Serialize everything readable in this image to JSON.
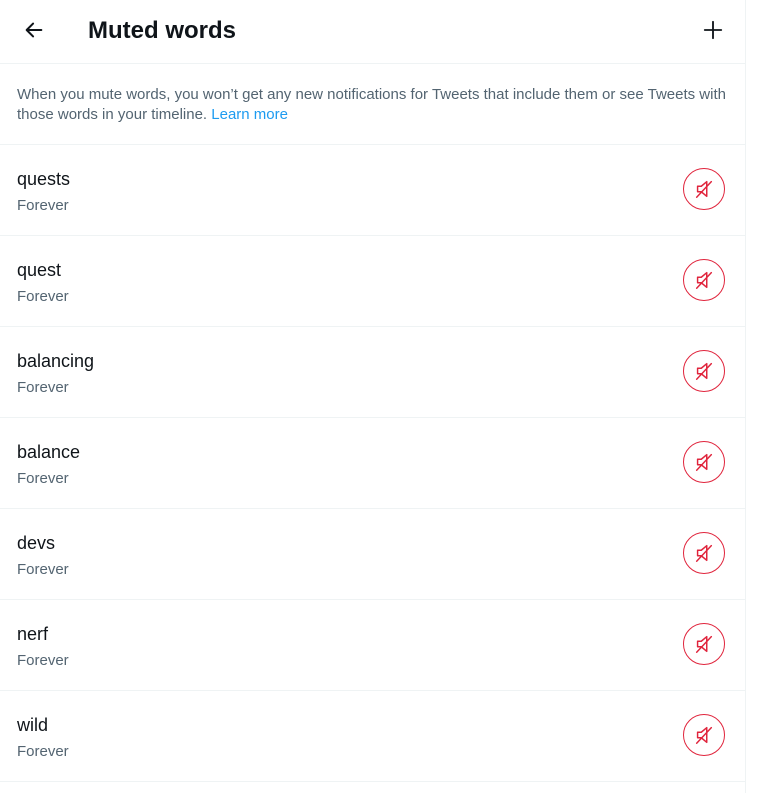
{
  "header": {
    "title": "Muted words",
    "back_icon": "arrow-left-icon",
    "add_icon": "plus-icon"
  },
  "description": {
    "text": "When you mute words, you won’t get any new notifications for Tweets that include them or see Tweets with those words in your timeline. ",
    "link_label": "Learn more"
  },
  "muted_words": [
    {
      "word": "quests",
      "duration": "Forever"
    },
    {
      "word": "quest",
      "duration": "Forever"
    },
    {
      "word": "balancing",
      "duration": "Forever"
    },
    {
      "word": "balance",
      "duration": "Forever"
    },
    {
      "word": "devs",
      "duration": "Forever"
    },
    {
      "word": "nerf",
      "duration": "Forever"
    },
    {
      "word": "wild",
      "duration": "Forever"
    }
  ],
  "colors": {
    "text_primary": "#0f1419",
    "text_secondary": "#536471",
    "link": "#1d9bf0",
    "unmute_red": "#e0243c",
    "divider": "#eff3f4"
  },
  "unmute_icon": "speaker-muted-icon"
}
